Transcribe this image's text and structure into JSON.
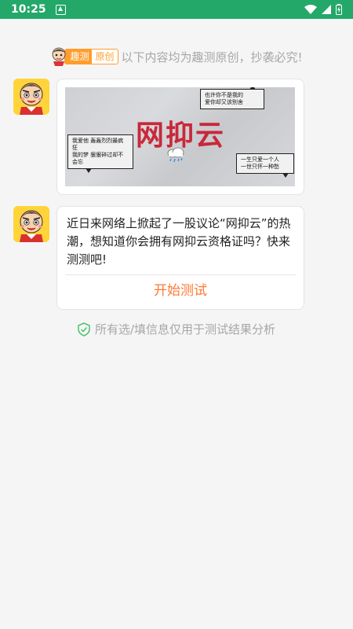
{
  "status": {
    "time": "10:25"
  },
  "notice": {
    "badge_left": "趣测",
    "badge_right": "原创",
    "text": "以下内容均为趣测原创，抄袭必究!"
  },
  "card": {
    "title": "网抑云",
    "bubble_top_right": [
      "也许你不是我的",
      "爱你却又该别舍"
    ],
    "bubble_left": [
      "我爱他 轰轰烈烈最疯狂",
      "我的梦 狠狠碎过却不会忘"
    ],
    "bubble_bottom_right": [
      "一生只爱一个人",
      "一世只怀一种愁"
    ],
    "weather_icon": "rain-cloud-icon"
  },
  "message": {
    "text": "近日来网络上掀起了一股议论“网抑云”的热潮，想知道你会拥有网抑云资格证吗？快来测测吧!",
    "button": "开始测试"
  },
  "privacy": {
    "text": "所有选/填信息仅用于测试结果分析"
  },
  "colors": {
    "statusbar": "#23a86a",
    "accent": "#ff7a36",
    "badge": "#ff9d2d",
    "title_red": "#c8283a"
  }
}
